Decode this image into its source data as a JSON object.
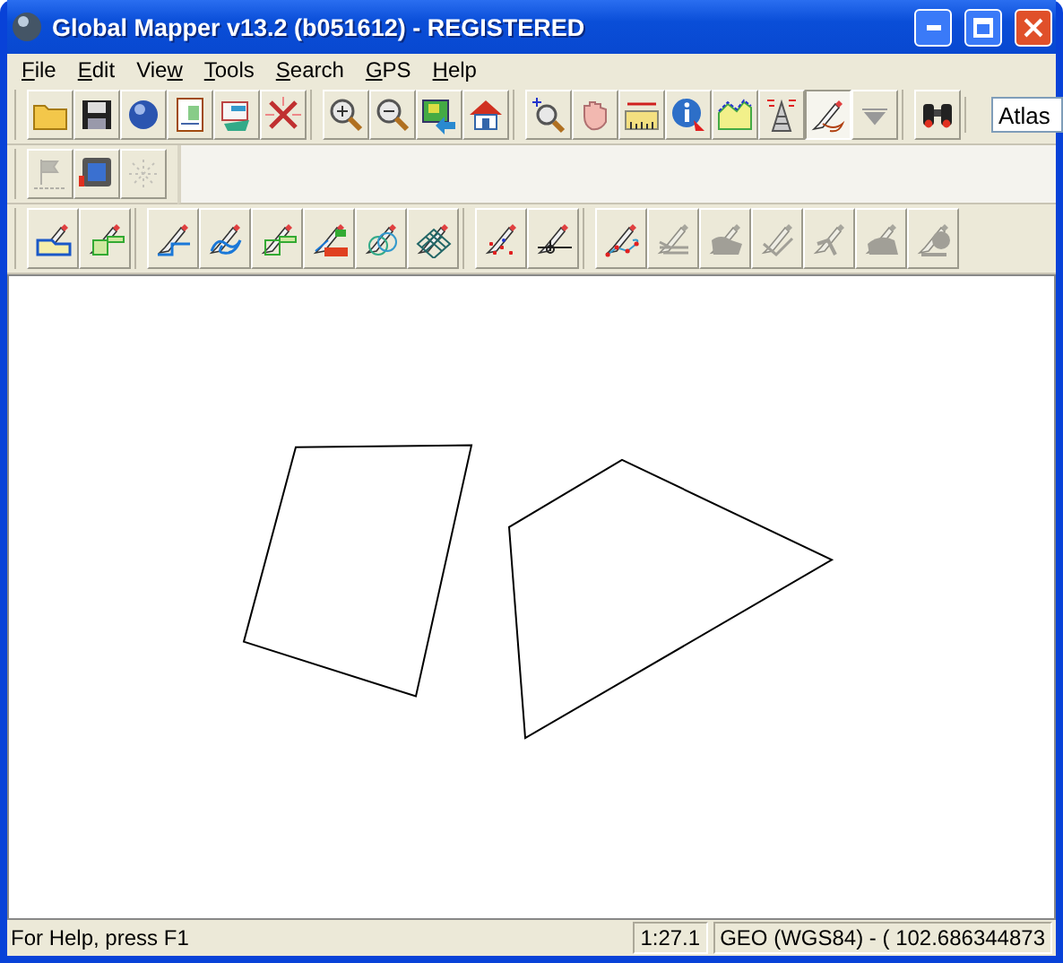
{
  "window": {
    "title": "Global Mapper v13.2 (b051612) - REGISTERED"
  },
  "menu": [
    {
      "key": "F",
      "post": "ile"
    },
    {
      "key": "E",
      "post": "dit"
    },
    {
      "pre": "Vie",
      "key": "w"
    },
    {
      "key": "T",
      "post": "ools"
    },
    {
      "key": "S",
      "post": "earch"
    },
    {
      "key": "G",
      "post": "PS"
    },
    {
      "key": "H",
      "post": "elp"
    }
  ],
  "toolbars": [
    {
      "groups": [
        [
          {
            "kind": "folder",
            "disabled": false,
            "pressed": false
          },
          {
            "kind": "floppy",
            "disabled": false,
            "pressed": false
          },
          {
            "kind": "globe",
            "disabled": false,
            "pressed": false
          },
          {
            "kind": "document",
            "disabled": false,
            "pressed": false
          },
          {
            "kind": "layers",
            "disabled": false,
            "pressed": false
          },
          {
            "kind": "tools",
            "disabled": false,
            "pressed": false
          }
        ],
        [
          {
            "kind": "zoom-in",
            "disabled": false,
            "pressed": false
          },
          {
            "kind": "zoom-out",
            "disabled": false,
            "pressed": false
          },
          {
            "kind": "image-arrow",
            "disabled": false,
            "pressed": false
          },
          {
            "kind": "home",
            "disabled": false,
            "pressed": false
          }
        ],
        [
          {
            "kind": "zoom-box",
            "disabled": false,
            "pressed": false
          },
          {
            "kind": "hand",
            "disabled": false,
            "pressed": false
          },
          {
            "kind": "ruler",
            "disabled": false,
            "pressed": false
          },
          {
            "kind": "info",
            "disabled": false,
            "pressed": false
          },
          {
            "kind": "profile",
            "disabled": false,
            "pressed": false
          },
          {
            "kind": "tower",
            "disabled": false,
            "pressed": false
          },
          {
            "kind": "pencil",
            "disabled": false,
            "pressed": true
          },
          {
            "kind": "triangle",
            "disabled": false,
            "pressed": false
          }
        ],
        [
          {
            "kind": "binoculars",
            "disabled": false,
            "pressed": false
          }
        ]
      ],
      "field": {
        "value": "Atlas"
      }
    },
    {
      "groups": [
        [
          {
            "kind": "flag",
            "disabled": true,
            "pressed": false
          },
          {
            "kind": "monitor",
            "disabled": false,
            "pressed": false
          },
          {
            "kind": "sparkle",
            "disabled": true,
            "pressed": false
          }
        ]
      ]
    },
    {
      "groups": [
        [
          {
            "kind": "area",
            "disabled": false,
            "pressed": false
          },
          {
            "kind": "rect-area",
            "disabled": false,
            "pressed": false
          }
        ],
        [
          {
            "kind": "line",
            "disabled": false,
            "pressed": false
          },
          {
            "kind": "curve",
            "disabled": false,
            "pressed": false
          },
          {
            "kind": "rect-line",
            "disabled": false,
            "pressed": false
          },
          {
            "kind": "cogo",
            "disabled": false,
            "pressed": false
          },
          {
            "kind": "circles",
            "disabled": false,
            "pressed": false
          },
          {
            "kind": "grid",
            "disabled": false,
            "pressed": false
          }
        ],
        [
          {
            "kind": "points",
            "disabled": false,
            "pressed": false
          },
          {
            "kind": "point-line",
            "disabled": false,
            "pressed": false
          }
        ],
        [
          {
            "kind": "vertex-line",
            "disabled": false,
            "pressed": false
          },
          {
            "kind": "edit-lines",
            "disabled": true,
            "pressed": false
          },
          {
            "kind": "edit-area",
            "disabled": true,
            "pressed": false
          },
          {
            "kind": "edit-stroke",
            "disabled": true,
            "pressed": false
          },
          {
            "kind": "edit-arrow",
            "disabled": true,
            "pressed": false
          },
          {
            "kind": "edit-blob",
            "disabled": true,
            "pressed": false
          },
          {
            "kind": "edit-tree",
            "disabled": true,
            "pressed": false
          }
        ]
      ]
    }
  ],
  "status_bar": {
    "help": "For Help, press F1",
    "scale": "1:27.1",
    "coordinates": "GEO (WGS84) - ( 102.686344873"
  }
}
